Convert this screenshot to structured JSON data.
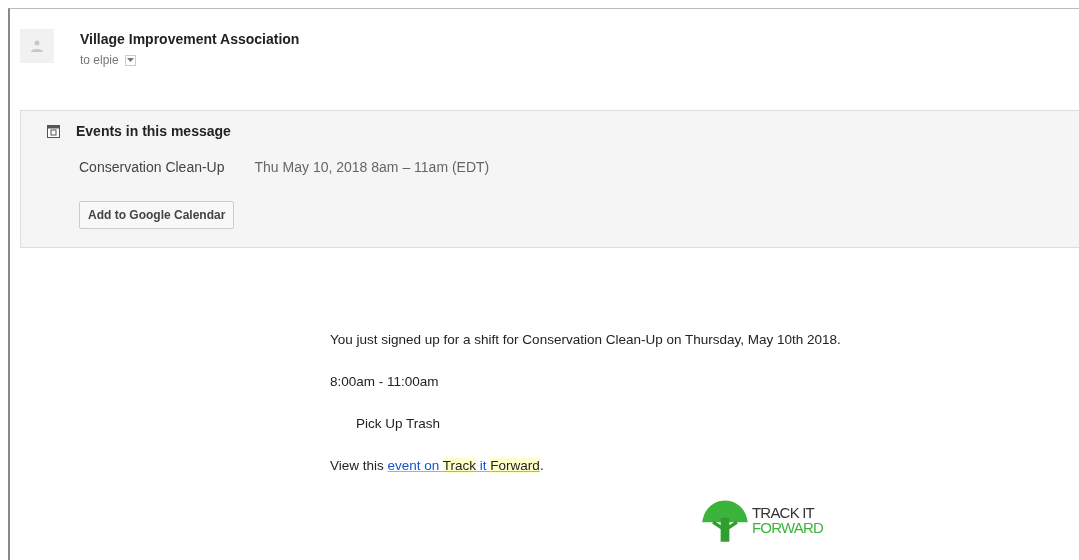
{
  "sender": {
    "name": "Village Improvement Association",
    "recipient": "to elpie"
  },
  "events": {
    "title": "Events in this message",
    "items": [
      {
        "name": "Conservation Clean-Up",
        "when": "Thu May 10, 2018 8am – 11am (EDT)"
      }
    ],
    "button": "Add to Google Calendar"
  },
  "body": {
    "intro": "You just signed up for a shift for Conservation Clean-Up on Thursday, May 10th 2018.",
    "time": "8:00am - 11:00am",
    "task": "Pick Up Trash",
    "view_prefix": "View this ",
    "link": [
      {
        "text": "event on ",
        "highlighted": false
      },
      {
        "text": "Track",
        "highlighted": true
      },
      {
        "text": " it ",
        "highlighted": false
      },
      {
        "text": "Forward",
        "highlighted": true
      }
    ],
    "view_suffix": "."
  },
  "logo": {
    "line_1": "TRACK IT",
    "line_2": "FORWARD"
  }
}
